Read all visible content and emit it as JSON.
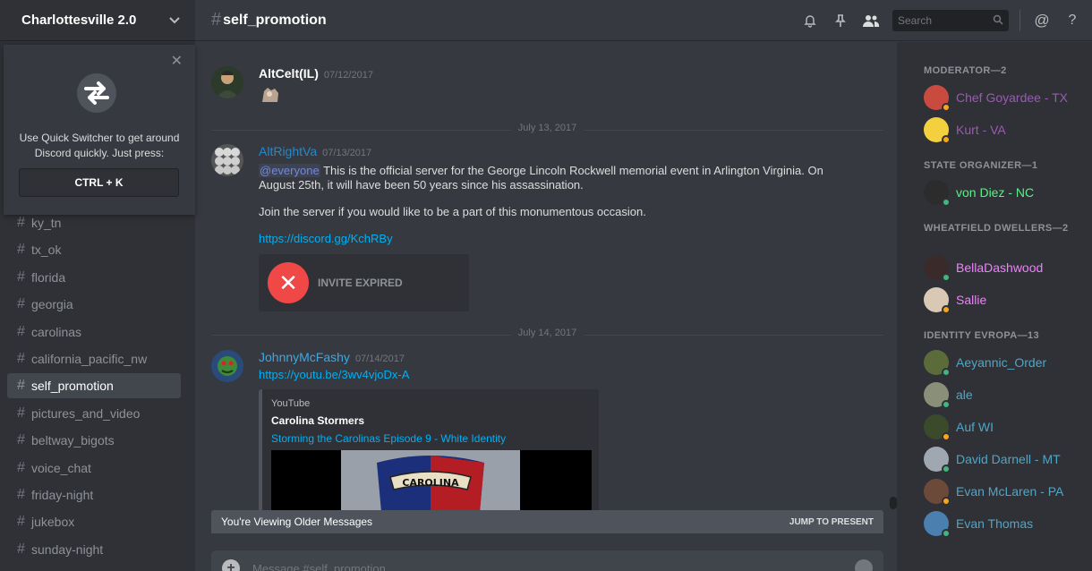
{
  "guild": {
    "name": "Charlottesville 2.0"
  },
  "quick_switcher": {
    "text_line1": "Use Quick Switcher to get around",
    "text_line2": "Discord quickly. Just press:",
    "shortcut": "CTRL + K"
  },
  "channels": [
    {
      "name": "ky_tn",
      "active": false
    },
    {
      "name": "tx_ok",
      "active": false
    },
    {
      "name": "florida",
      "active": false
    },
    {
      "name": "georgia",
      "active": false
    },
    {
      "name": "carolinas",
      "active": false
    },
    {
      "name": "california_pacific_nw",
      "active": false
    },
    {
      "name": "self_promotion",
      "active": true
    },
    {
      "name": "pictures_and_video",
      "active": false
    },
    {
      "name": "beltway_bigots",
      "active": false
    },
    {
      "name": "voice_chat",
      "active": false
    },
    {
      "name": "friday-night",
      "active": false
    },
    {
      "name": "jukebox",
      "active": false
    },
    {
      "name": "sunday-night",
      "active": false
    }
  ],
  "header": {
    "hash": "#",
    "channel": "self_promotion",
    "search_placeholder": "Search",
    "icons": [
      "bell-icon",
      "pin-icon",
      "members-icon",
      "search-icon",
      "at-icon",
      "help-icon"
    ],
    "at": "@",
    "help": "?"
  },
  "messages": [
    {
      "author": "AltCelt(IL)",
      "author_color": "#ffffff",
      "timestamp": "07/12/2017"
    },
    {
      "author": "AltRightVa",
      "author_color": "#1f8ad1",
      "timestamp": "07/13/2017",
      "mention": "@everyone",
      "text1": " This is the official server for the George Lincoln Rockwell memorial event in Arlington Virginia. On August 25th, it will have been 50 years since his assassination.",
      "text2": "Join the server if you would like to be a part of this monumentous occasion.",
      "link": "https://discord.gg/KchRBy",
      "invite_label": "INVITE EXPIRED"
    },
    {
      "author": "JohnnyMcFashy",
      "author_color": "#3aa8e6",
      "timestamp": "07/14/2017",
      "link": "https://youtu.be/3wv4vjoDx-A",
      "embed": {
        "provider": "YouTube",
        "author": "Carolina Stormers",
        "title": "Storming the Carolinas Episode 9 - White Identity",
        "image_text": "CAROLINA"
      }
    }
  ],
  "dividers": [
    "July 13, 2017",
    "July 14, 2017"
  ],
  "older_bar": {
    "label": "You're Viewing Older Messages",
    "jump": "JUMP TO PRESENT"
  },
  "composer": {
    "plus": "+",
    "placeholder": "Message #self_promotion"
  },
  "members": {
    "roles": [
      {
        "title": "MODERATOR—2",
        "members": [
          {
            "name": "Chef Goyardee - TX",
            "color": "#9b59b6",
            "status": "#faa61a"
          },
          {
            "name": "Kurt - VA",
            "color": "#9b59b6",
            "status": "#faa61a"
          }
        ]
      },
      {
        "title": "STATE ORGANIZER—1",
        "members": [
          {
            "name": "von Diez - NC",
            "color": "#57f287",
            "status": "#43b581"
          }
        ]
      },
      {
        "title": "WHEATFIELD DWELLERS—2",
        "members": [
          {
            "name": "BellaDashwood",
            "color": "#f47fff",
            "status": "#43b581"
          },
          {
            "name": "Sallie",
            "color": "#f47fff",
            "status": "#faa61a"
          }
        ]
      },
      {
        "title": "IDENTITY EVROPA—13",
        "members": [
          {
            "name": "Aeyannic_Order",
            "color": "#4fa6c6",
            "status": "#43b581"
          },
          {
            "name": "ale",
            "color": "#4fa6c6",
            "status": "#43b581"
          },
          {
            "name": "Auf WI",
            "color": "#4fa6c6",
            "status": "#faa61a"
          },
          {
            "name": "David Darnell - MT",
            "color": "#4fa6c6",
            "status": "#43b581"
          },
          {
            "name": "Evan McLaren - PA",
            "color": "#4fa6c6",
            "status": "#faa61a"
          },
          {
            "name": "Evan Thomas",
            "color": "#4fa6c6",
            "status": "#43b581"
          }
        ]
      }
    ]
  }
}
